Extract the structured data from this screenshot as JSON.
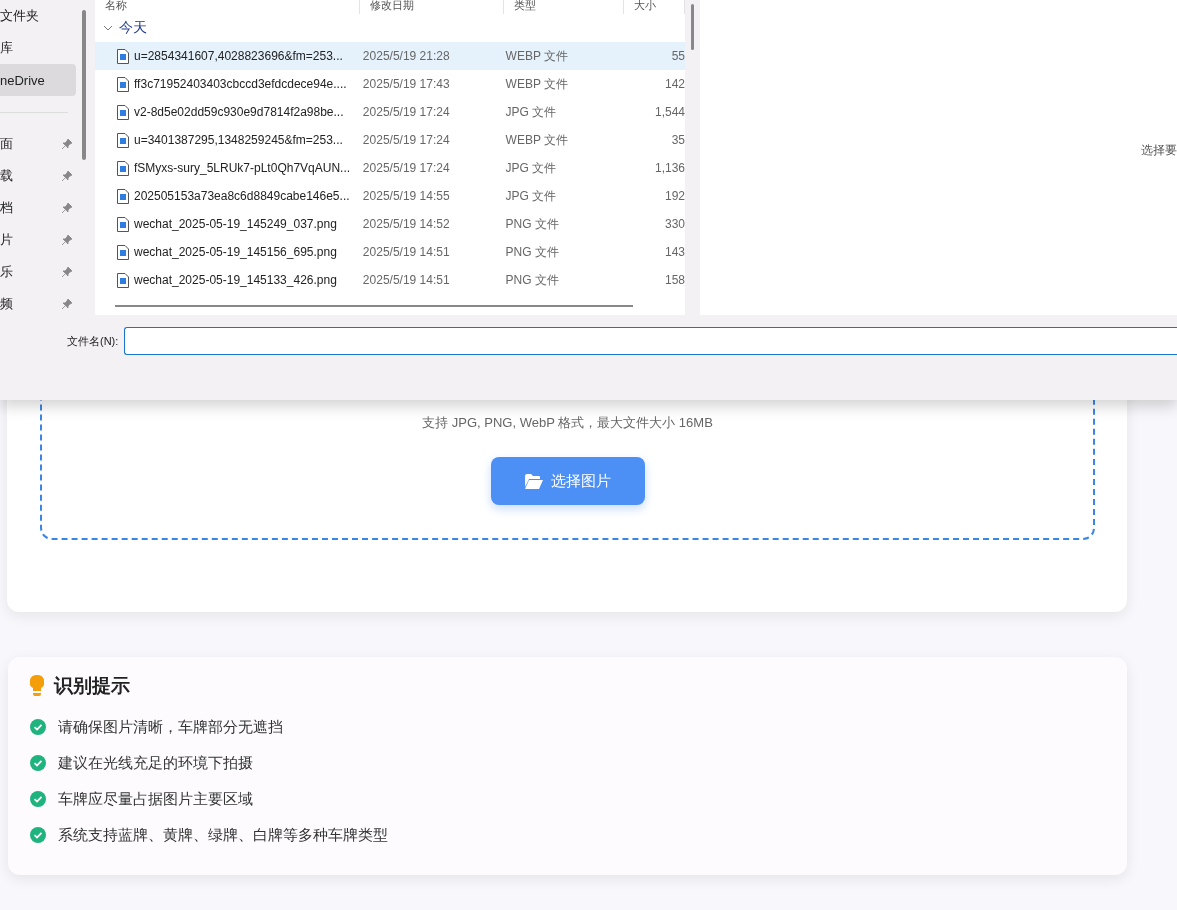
{
  "dialog": {
    "sidebar": {
      "items": [
        {
          "label": "文件夹",
          "selected": false,
          "pinned": false
        },
        {
          "label": "库",
          "selected": false,
          "pinned": false
        },
        {
          "label": "neDrive",
          "selected": true,
          "pinned": false
        },
        {
          "label": "面",
          "selected": false,
          "pinned": true
        },
        {
          "label": "载",
          "selected": false,
          "pinned": true
        },
        {
          "label": "档",
          "selected": false,
          "pinned": true
        },
        {
          "label": "片",
          "selected": false,
          "pinned": true
        },
        {
          "label": "乐",
          "selected": false,
          "pinned": true
        },
        {
          "label": "频",
          "selected": false,
          "pinned": true
        }
      ]
    },
    "columns": [
      "名称",
      "修改日期",
      "类型",
      "大小"
    ],
    "group": {
      "label": "今天",
      "expanded": true
    },
    "files": [
      {
        "name": "u=2854341607,4028823696&fm=253...",
        "date": "2025/5/19 21:28",
        "type": "WEBP 文件",
        "size": "55",
        "selected": true
      },
      {
        "name": "ff3c71952403403cbccd3efdcdece94e....",
        "date": "2025/5/19 17:43",
        "type": "WEBP 文件",
        "size": "142",
        "selected": false
      },
      {
        "name": "v2-8d5e02dd59c930e9d7814f2a98be...",
        "date": "2025/5/19 17:24",
        "type": "JPG 文件",
        "size": "1,544",
        "selected": false
      },
      {
        "name": "u=3401387295,1348259245&fm=253...",
        "date": "2025/5/19 17:24",
        "type": "WEBP 文件",
        "size": "35",
        "selected": false
      },
      {
        "name": "fSMyxs-sury_5LRUk7-pLt0Qh7VqAUN...",
        "date": "2025/5/19 17:24",
        "type": "JPG 文件",
        "size": "1,136",
        "selected": false
      },
      {
        "name": "202505153a73ea8c6d8849cabe146e5...",
        "date": "2025/5/19 14:55",
        "type": "JPG 文件",
        "size": "192",
        "selected": false
      },
      {
        "name": "wechat_2025-05-19_145249_037.png",
        "date": "2025/5/19 14:52",
        "type": "PNG 文件",
        "size": "330",
        "selected": false
      },
      {
        "name": "wechat_2025-05-19_145156_695.png",
        "date": "2025/5/19 14:51",
        "type": "PNG 文件",
        "size": "143",
        "selected": false
      },
      {
        "name": "wechat_2025-05-19_145133_426.png",
        "date": "2025/5/19 14:51",
        "type": "PNG 文件",
        "size": "158",
        "selected": false
      }
    ],
    "preview_hint": "选择要",
    "filename_label": "文件名(N):"
  },
  "upload": {
    "hint": "支持 JPG, PNG, WebP 格式，最大文件大小 16MB",
    "button": "选择图片"
  },
  "tips": {
    "title": "识别提示",
    "items": [
      "请确保图片清晰，车牌部分无遮挡",
      "建议在光线充足的环境下拍摄",
      "车牌应尽量占据图片主要区域",
      "系统支持蓝牌、黄牌、绿牌、白牌等多种车牌类型"
    ]
  }
}
